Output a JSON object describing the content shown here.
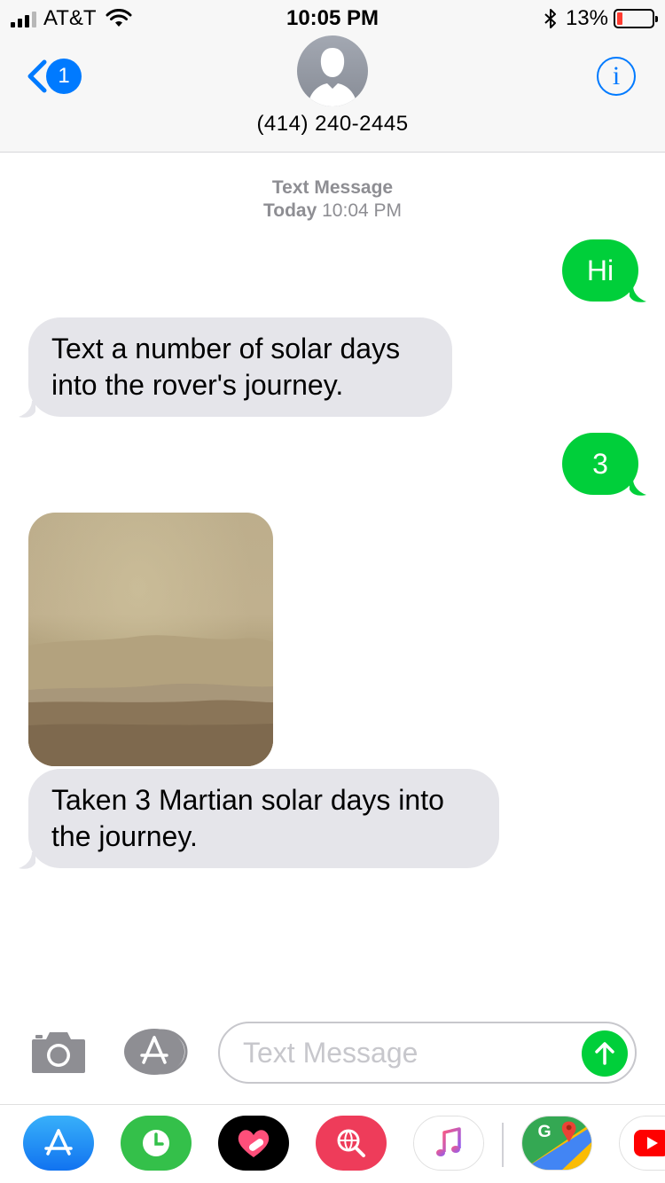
{
  "status_bar": {
    "carrier": "AT&T",
    "time": "10:05 PM",
    "battery_percent": "13%",
    "battery_level": 0.13,
    "icons": [
      "signal-icon",
      "wifi-icon",
      "bluetooth-icon",
      "battery-icon"
    ]
  },
  "header": {
    "back_badge": "1",
    "contact_name": "(414) 240-2445",
    "info_glyph": "i",
    "icons": [
      "back-chevron-icon",
      "avatar-silhouette-icon",
      "info-icon"
    ]
  },
  "conversation": {
    "timestamp_label": "Text Message",
    "timestamp_day": "Today",
    "timestamp_time": "10:04 PM",
    "messages": [
      {
        "direction": "sent",
        "text": "Hi"
      },
      {
        "direction": "received",
        "text": "Text a number of solar days into the rover's journey."
      },
      {
        "direction": "sent",
        "text": "3"
      },
      {
        "direction": "received",
        "type": "image",
        "description": "Martian landscape photo"
      },
      {
        "direction": "received",
        "text": "Taken 3 Martian solar days into the journey."
      }
    ]
  },
  "input_bar": {
    "placeholder": "Text Message",
    "icons": [
      "camera-icon",
      "app-store-icon",
      "send-arrow-icon"
    ]
  },
  "app_drawer": {
    "apps": [
      "app-store-icon",
      "activity-clock-icon",
      "heart-sticker-icon",
      "web-search-icon",
      "music-icon",
      "google-maps-icon",
      "youtube-icon"
    ]
  },
  "colors": {
    "accent_blue": "#007aff",
    "sent_bubble": "#00cf3a",
    "received_bubble": "#e5e5ea",
    "timestamp_gray": "#8e8e93",
    "battery_low": "#ff3b30"
  }
}
